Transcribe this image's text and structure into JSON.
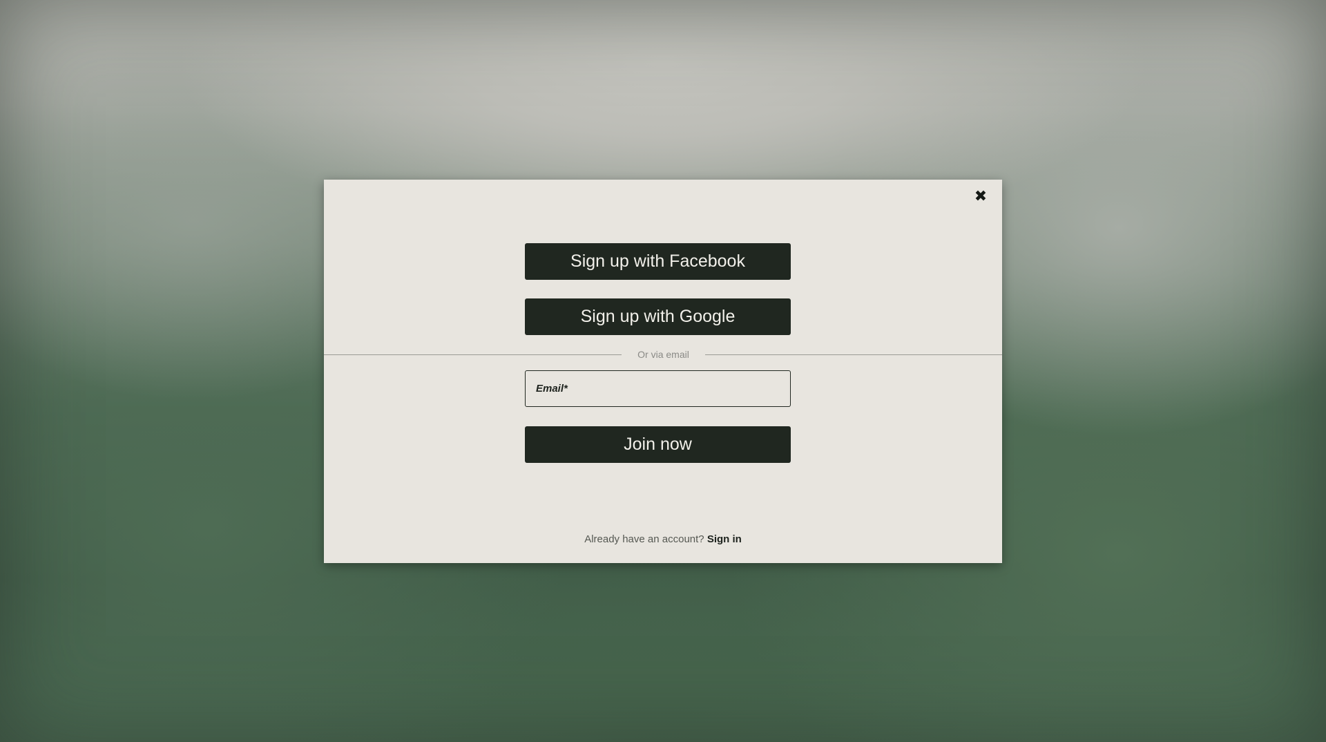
{
  "modal": {
    "close_icon": "close-icon",
    "close_glyph": "✖",
    "facebook_label": "Sign up with Facebook",
    "google_label": "Sign up with Google",
    "divider_text": "Or via email",
    "email_placeholder": "Email*",
    "email_value": "",
    "join_label": "Join now",
    "footer_text": "Already have an account?",
    "signin_label": "Sign in"
  },
  "colors": {
    "modal_background": "#e8e5df",
    "button_background": "#202720",
    "button_text": "#f2f0ea"
  }
}
